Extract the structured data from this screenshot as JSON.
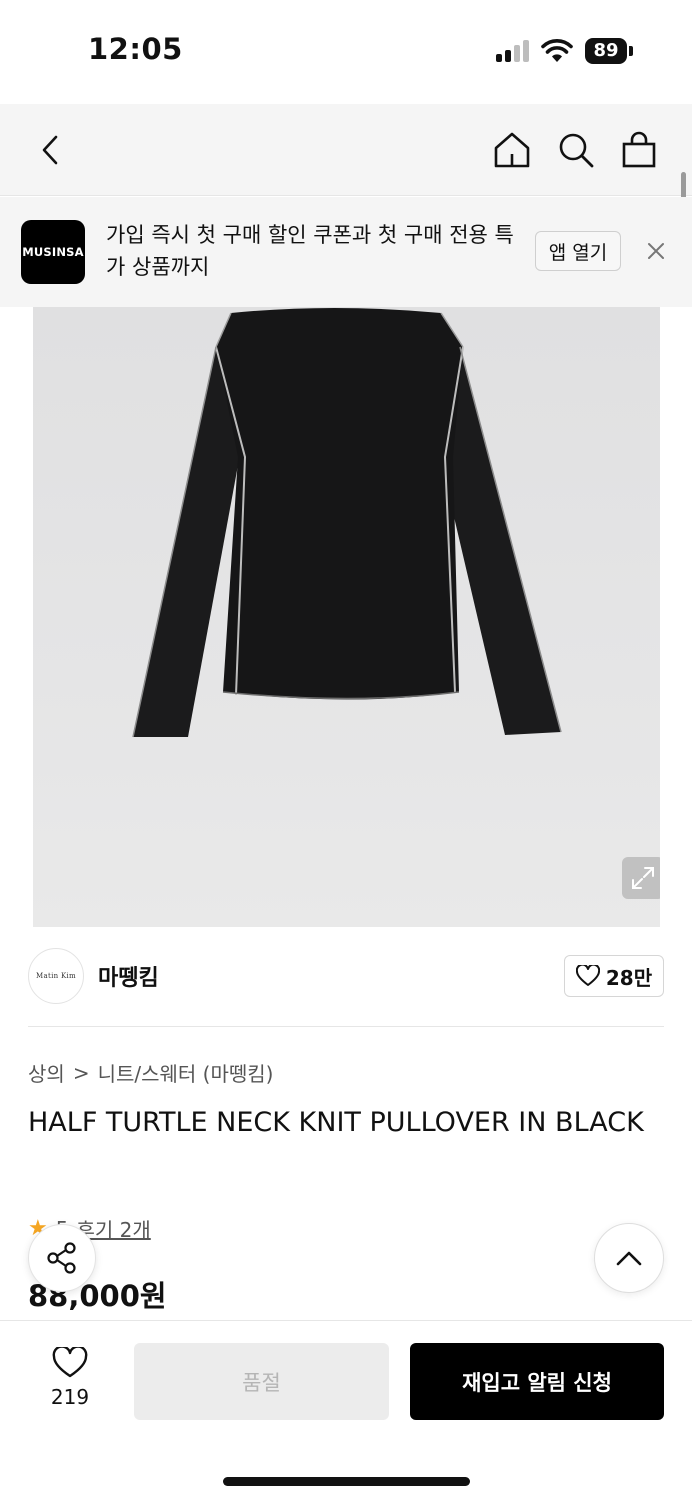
{
  "status_bar": {
    "time": "12:05",
    "battery": "89"
  },
  "header": {
    "icons": [
      "back-icon",
      "home-icon",
      "search-icon",
      "shopping-bag-icon"
    ]
  },
  "promo": {
    "logo": "MUSINSA",
    "text": "가입 즉시 첫 구매 할인 쿠폰과 첫 구매 전용 특가 상품까지",
    "open_app": "앱 열기",
    "close_icon": "close-icon"
  },
  "product": {
    "image_subject": "black knit pullover",
    "expand_icon": "expand-icon",
    "brand_logo": "Matin Kim",
    "brand_name": "마뗑킴",
    "brand_likes": "28만",
    "breadcrumb": {
      "category": "상의",
      "separator": ">",
      "subcategory": "니트/스웨터 (마뗑킴)"
    },
    "title": "HALF TURTLE NECK KNIT PULLOVER IN BLACK",
    "rating": "5",
    "reviews": "후기 2개",
    "price": "88,000원"
  },
  "bottom_bar": {
    "wish_count": "219",
    "soldout_label": "품절",
    "restock_label": "재입고 알림 신청"
  },
  "colors": {
    "brand_black": "#000000",
    "accent_star": "#f5a623",
    "disabled_bg": "#ececec"
  }
}
